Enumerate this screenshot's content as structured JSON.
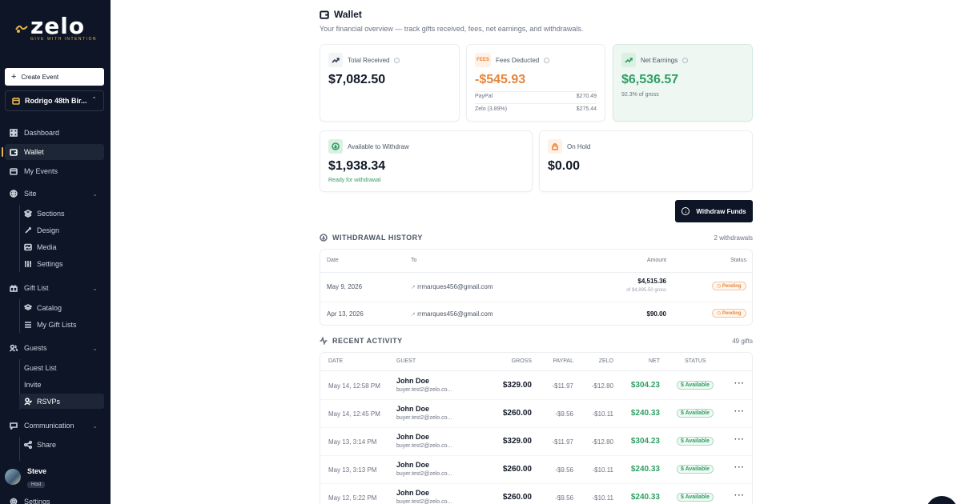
{
  "brand": {
    "name": "zelo",
    "tagline": "GIVE WITH INTENTION"
  },
  "sidebar": {
    "create_label": "Create Event",
    "event_name": "Rodrigo 48th Bir...",
    "nav": {
      "dashboard": "Dashboard",
      "wallet": "Wallet",
      "my_events": "My Events",
      "site": "Site",
      "sections": "Sections",
      "design": "Design",
      "media": "Media",
      "settings": "Settings",
      "gift_list": "Gift List",
      "catalog": "Catalog",
      "my_gift_lists": "My Gift Lists",
      "guests": "Guests",
      "guest_list": "Guest List",
      "invite": "Invite",
      "rsvps": "RSVPs",
      "communication": "Communication",
      "share": "Share"
    },
    "user": {
      "name": "Steve",
      "role": "Host"
    },
    "bottom_settings": "Settings"
  },
  "page": {
    "title": "Wallet",
    "subtitle": "Your financial overview — track gifts received, fees, net earnings, and withdrawals."
  },
  "cards": {
    "total_received": {
      "label": "Total Received",
      "value": "$7,082.50"
    },
    "fees": {
      "badge": "FEES",
      "label": "Fees Deducted",
      "value": "-$545.93",
      "rows": [
        {
          "name": "PayPal",
          "amount": "$270.49"
        },
        {
          "name": "Zelo (3.89%)",
          "amount": "$275.44"
        }
      ]
    },
    "net": {
      "label": "Net Earnings",
      "value": "$6,536.57",
      "note": "92.3% of gross"
    },
    "available": {
      "label": "Available to Withdraw",
      "value": "$1,938.34",
      "note": "Ready for withdrawal"
    },
    "on_hold": {
      "label": "On Hold",
      "value": "$0.00"
    }
  },
  "withdraw_button": "Withdraw Funds",
  "withdrawals": {
    "title": "WITHDRAWAL HISTORY",
    "count": "2 withdrawals",
    "headers": {
      "date": "Date",
      "to": "To",
      "amount": "Amount",
      "status": "Status"
    },
    "rows": [
      {
        "date": "May 9, 2026",
        "to": "rrmarques456@gmail.com",
        "amount": "$4,515.36",
        "sub": "of $4,895.50 gross",
        "status": "Pending"
      },
      {
        "date": "Apr 13, 2026",
        "to": "rrmarques456@gmail.com",
        "amount": "$90.00",
        "sub": "",
        "status": "Pending"
      }
    ]
  },
  "activity": {
    "title": "RECENT ACTIVITY",
    "count": "49 gifts",
    "headers": {
      "date": "DATE",
      "guest": "GUEST",
      "gross": "GROSS",
      "paypal": "PAYPAL",
      "zelo": "ZELO",
      "net": "NET",
      "status": "STATUS"
    },
    "rows": [
      {
        "date": "May 14, 12:58 PM",
        "name": "John Doe",
        "email": "buyer.test2@zelo.co...",
        "gross": "$329.00",
        "paypal": "-$11.97",
        "zelo": "-$12.80",
        "net": "$304.23",
        "status": "Available"
      },
      {
        "date": "May 14, 12:45 PM",
        "name": "John Doe",
        "email": "buyer.test2@zelo.co...",
        "gross": "$260.00",
        "paypal": "-$9.56",
        "zelo": "-$10.11",
        "net": "$240.33",
        "status": "Available"
      },
      {
        "date": "May 13, 3:14 PM",
        "name": "John Doe",
        "email": "buyer.test2@zelo.co...",
        "gross": "$329.00",
        "paypal": "-$11.97",
        "zelo": "-$12.80",
        "net": "$304.23",
        "status": "Available"
      },
      {
        "date": "May 13, 3:13 PM",
        "name": "John Doe",
        "email": "buyer.test2@zelo.co...",
        "gross": "$260.00",
        "paypal": "-$9.56",
        "zelo": "-$10.11",
        "net": "$240.33",
        "status": "Available"
      },
      {
        "date": "May 12, 5:22 PM",
        "name": "John Doe",
        "email": "buyer.test2@zelo.co...",
        "gross": "$260.00",
        "paypal": "-$9.56",
        "zelo": "-$10.11",
        "net": "$240.33",
        "status": "Available"
      }
    ]
  },
  "colors": {
    "sidebar_bg": "#0d1526",
    "accent_gold": "#e5b44b",
    "positive": "#2f9e63",
    "fees": "#e8843a"
  }
}
